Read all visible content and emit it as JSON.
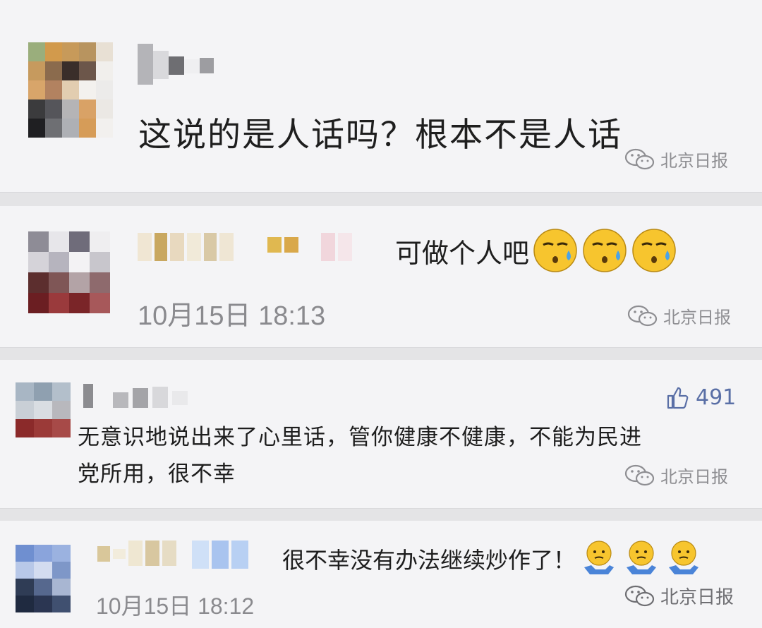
{
  "comments": [
    {
      "text": "这说的是人话吗？根本不是人话",
      "watermark": "北京日报"
    },
    {
      "text": "可做个人吧",
      "emoji": [
        "sweat-face-emoji",
        "sweat-face-emoji",
        "sweat-face-emoji"
      ],
      "time": "10月15日 18:13",
      "watermark": "北京日报"
    },
    {
      "line1": "无意识地说出来了心里话，管你健康不健康，不能为民进",
      "line2": "党所用，很不幸",
      "likes": "491",
      "watermark": "北京日报"
    },
    {
      "text": "很不幸没有办法继续炒作了！",
      "emoji": [
        "shrug-emoji",
        "shrug-emoji",
        "shrug-emoji"
      ],
      "time": "10月15日 18:12",
      "watermark": "北京日报"
    }
  ],
  "colors": {
    "text": "#1e1e1e",
    "time": "#8a8a8e",
    "like": "#5a6fa6",
    "card": "#f4f4f6"
  }
}
